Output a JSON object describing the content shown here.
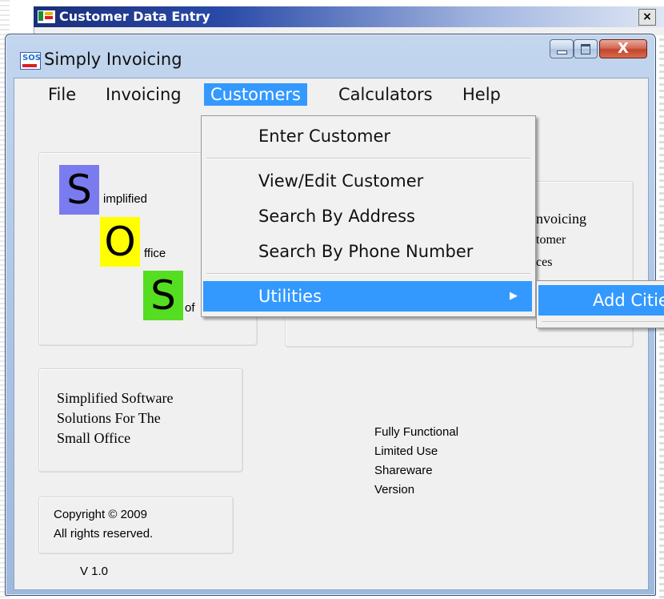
{
  "back_window": {
    "title": "Customer Data Entry",
    "close_label": "×"
  },
  "window": {
    "title": "Simply Invoicing",
    "icon_text": "SOS",
    "close_label": "X"
  },
  "menubar": {
    "items": [
      {
        "label": "File"
      },
      {
        "label": "Invoicing"
      },
      {
        "label": "Customers"
      },
      {
        "label": "Calculators"
      },
      {
        "label": "Help"
      }
    ],
    "active": "Customers"
  },
  "customers_menu": {
    "items": [
      {
        "label": "Enter Customer"
      },
      {
        "label": "View/Edit Customer"
      },
      {
        "label": "Search  By Address"
      },
      {
        "label": "Search By Phone Number"
      },
      {
        "label": "Utilities",
        "submenu_arrow": "▶"
      }
    ]
  },
  "utilities_submenu": {
    "items": [
      {
        "label": "Add Citie"
      }
    ]
  },
  "logo": {
    "letters": [
      {
        "letter": "S",
        "word": "implified",
        "color": "#7b7bf0"
      },
      {
        "letter": "O",
        "word": "ffice",
        "color": "#ffff00"
      },
      {
        "letter": "S",
        "word": "of",
        "color": "#55dd22"
      }
    ]
  },
  "right_panel": {
    "lines": [
      "nvoicing",
      "tomer",
      "ces"
    ]
  },
  "tagline": {
    "lines": [
      "Simplified Software",
      "Solutions For The",
      "Small Office"
    ]
  },
  "shareware": {
    "lines": [
      "Fully Functional",
      "Limited Use",
      "Shareware",
      "Version"
    ]
  },
  "copyright": {
    "lines": [
      "Copyright ©  2009",
      "All rights reserved."
    ]
  },
  "version": "V 1.0"
}
